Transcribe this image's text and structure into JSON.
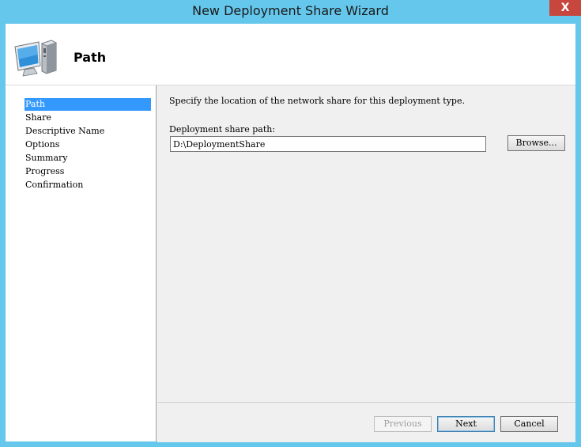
{
  "window": {
    "title": "New Deployment Share Wizard",
    "close_label": "X"
  },
  "header": {
    "title": "Path",
    "icon": "computer-icon"
  },
  "steps": [
    {
      "label": "Path",
      "active": true
    },
    {
      "label": "Share",
      "active": false
    },
    {
      "label": "Descriptive Name",
      "active": false
    },
    {
      "label": "Options",
      "active": false
    },
    {
      "label": "Summary",
      "active": false
    },
    {
      "label": "Progress",
      "active": false
    },
    {
      "label": "Confirmation",
      "active": false
    }
  ],
  "content": {
    "instruction": "Specify the location of the network share for this deployment type.",
    "path_label": "Deployment share path:",
    "path_value": "D:\\DeploymentShare",
    "browse_label": "Browse..."
  },
  "buttons": {
    "previous": "Previous",
    "next": "Next",
    "cancel": "Cancel"
  },
  "colors": {
    "titlebar": "#65c7ec",
    "selection": "#3399ff",
    "close": "#c7463d"
  }
}
